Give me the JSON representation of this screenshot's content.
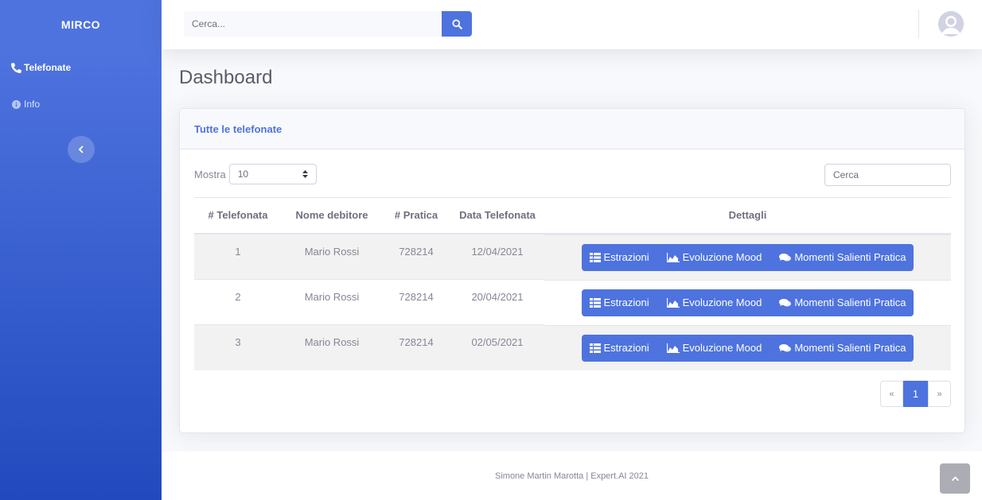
{
  "sidebar": {
    "brand": "MIRCO",
    "items": [
      {
        "label": "Telefonate",
        "icon": "phone-icon",
        "active": true
      },
      {
        "label": "Info",
        "icon": "info-icon",
        "active": false
      }
    ],
    "toggle_icon": "chevron-left-icon"
  },
  "topbar": {
    "search_placeholder": "Cerca...",
    "search_icon": "search-icon",
    "avatar_icon": "user-avatar-icon"
  },
  "page": {
    "title": "Dashboard"
  },
  "card": {
    "header": "Tutte le telefonate",
    "length_label": "Mostra",
    "length_value": "10",
    "filter_placeholder": "Cerca",
    "columns": [
      "# Telefonata",
      "Nome debitore",
      "# Pratica",
      "Data Telefonata",
      "Dettagli"
    ],
    "rows": [
      {
        "num": "1",
        "name": "Mario Rossi",
        "pratica": "728214",
        "date": "12/04/2021"
      },
      {
        "num": "2",
        "name": "Mario Rossi",
        "pratica": "728214",
        "date": "20/04/2021"
      },
      {
        "num": "3",
        "name": "Mario Rossi",
        "pratica": "728214",
        "date": "02/05/2021"
      }
    ],
    "actions": {
      "estrazioni": "Estrazioni",
      "evoluzione": "Evoluzione Mood",
      "momenti": "Momenti Salienti Pratica"
    },
    "pagination": {
      "prev": "«",
      "current": "1",
      "next": "»"
    }
  },
  "footer": {
    "text": "Simone Martin Marotta | Expert.AI 2021"
  },
  "colors": {
    "primary": "#4e73df",
    "sidebar_gradient_end": "#224abe"
  }
}
